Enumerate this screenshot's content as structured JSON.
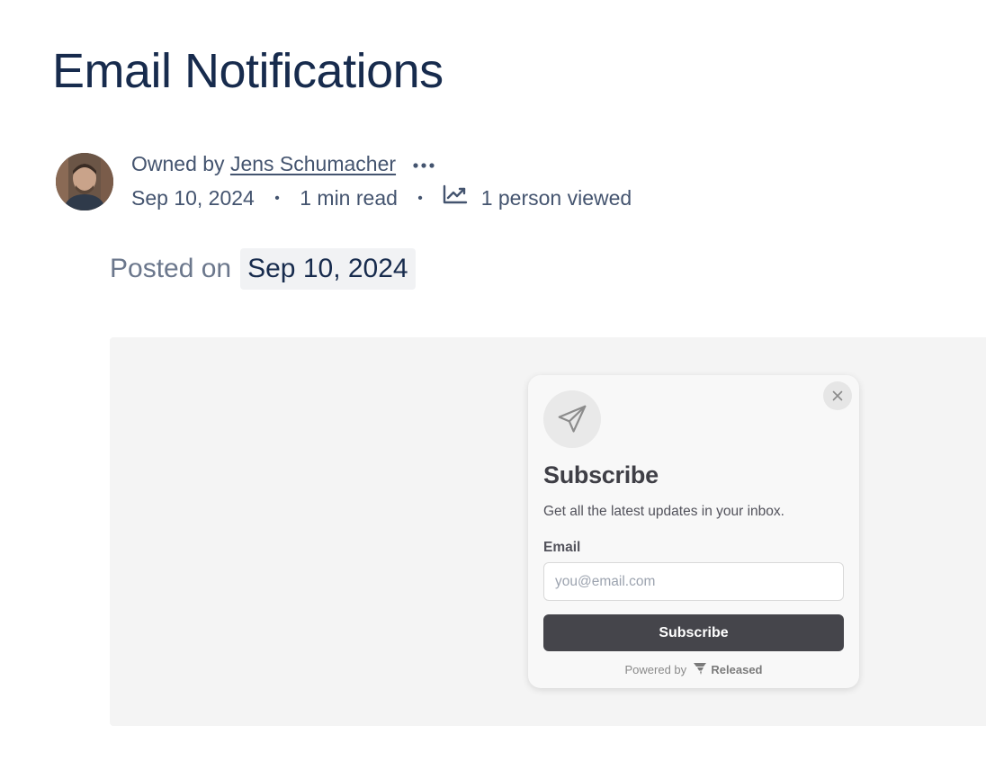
{
  "page": {
    "title": "Email Notifications"
  },
  "byline": {
    "owned_by_label": "Owned by",
    "owner_name": "Jens Schumacher",
    "date": "Sep 10, 2024",
    "read_time": "1 min read",
    "views": "1 person viewed",
    "separator": "•"
  },
  "posted": {
    "label": "Posted on",
    "date": "Sep 10, 2024"
  },
  "widget": {
    "title": "Subscribe",
    "description": "Get all the latest updates in your inbox.",
    "email_label": "Email",
    "email_placeholder": "you@email.com",
    "email_value": "",
    "button_label": "Subscribe",
    "powered_by": "Powered by",
    "brand": "Released"
  },
  "icons": {
    "more": "more-horizontal-icon",
    "views": "trending-up-icon",
    "close": "close-icon",
    "plane": "paper-plane-icon",
    "brand": "released-logo-icon"
  },
  "colors": {
    "title": "#172b4d",
    "meta": "#44546f",
    "embed_bg": "#f4f4f4",
    "button_bg": "#45454b"
  }
}
